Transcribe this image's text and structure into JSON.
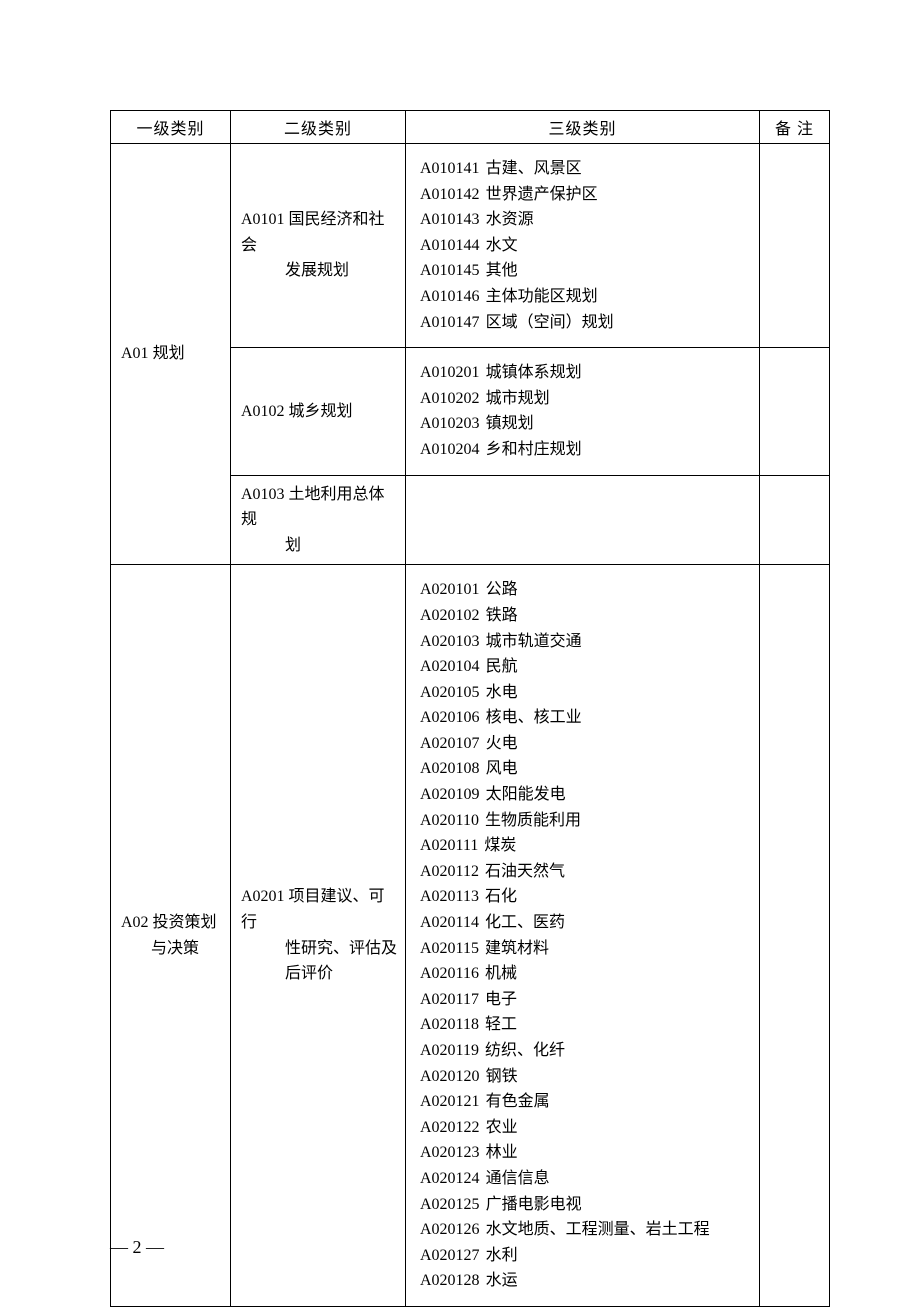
{
  "headers": {
    "c1": "一级类别",
    "c2": "二级类别",
    "c3": "三级类别",
    "c4": "备 注"
  },
  "lvl1": [
    {
      "code": "A01",
      "name": "规划"
    },
    {
      "code_line": "A02 投资策划",
      "line2": "与决策"
    }
  ],
  "lvl2": [
    {
      "line1": "A0101 国民经济和社会",
      "indent": "发展规划"
    },
    {
      "line1": "A0102 城乡规划"
    },
    {
      "line1": "A0103 土地利用总体规",
      "indent": "划"
    },
    {
      "line1": "A0201 项目建议、可行",
      "indent1": "性研究、评估及",
      "indent2": "后评价"
    }
  ],
  "lvl3_block_a0101": [
    {
      "code": "A010141",
      "name": "古建、风景区"
    },
    {
      "code": "A010142",
      "name": "世界遗产保护区"
    },
    {
      "code": "A010143",
      "name": "水资源"
    },
    {
      "code": "A010144",
      "name": "水文"
    },
    {
      "code": "A010145",
      "name": "其他"
    },
    {
      "code": "A010146",
      "name": "主体功能区规划"
    },
    {
      "code": "A010147",
      "name": "区域（空间）规划"
    }
  ],
  "lvl3_block_a0102": [
    {
      "code": "A010201",
      "name": "城镇体系规划"
    },
    {
      "code": "A010202",
      "name": "城市规划"
    },
    {
      "code": "A010203",
      "name": "镇规划"
    },
    {
      "code": "A010204",
      "name": "乡和村庄规划"
    }
  ],
  "lvl3_block_a0201": [
    {
      "code": "A020101",
      "name": "公路"
    },
    {
      "code": "A020102",
      "name": "铁路"
    },
    {
      "code": "A020103",
      "name": "城市轨道交通"
    },
    {
      "code": "A020104",
      "name": "民航"
    },
    {
      "code": "A020105",
      "name": "水电"
    },
    {
      "code": "A020106",
      "name": "核电、核工业"
    },
    {
      "code": "A020107",
      "name": "火电"
    },
    {
      "code": "A020108",
      "name": "风电"
    },
    {
      "code": "A020109",
      "name": "太阳能发电"
    },
    {
      "code": "A020110",
      "name": "生物质能利用"
    },
    {
      "code": "A020111",
      "name": "煤炭"
    },
    {
      "code": "A020112",
      "name": "石油天然气"
    },
    {
      "code": "A020113",
      "name": "石化"
    },
    {
      "code": "A020114",
      "name": "化工、医药"
    },
    {
      "code": "A020115",
      "name": "建筑材料"
    },
    {
      "code": "A020116",
      "name": "机械"
    },
    {
      "code": "A020117",
      "name": "电子"
    },
    {
      "code": "A020118",
      "name": "轻工"
    },
    {
      "code": "A020119",
      "name": "纺织、化纤"
    },
    {
      "code": "A020120",
      "name": "钢铁"
    },
    {
      "code": "A020121",
      "name": "有色金属"
    },
    {
      "code": "A020122",
      "name": "农业"
    },
    {
      "code": "A020123",
      "name": "林业"
    },
    {
      "code": "A020124",
      "name": "通信信息"
    },
    {
      "code": "A020125",
      "name": "广播电影电视"
    },
    {
      "code": "A020126",
      "name": "水文地质、工程测量、岩土工程"
    },
    {
      "code": "A020127",
      "name": "水利"
    },
    {
      "code": "A020128",
      "name": "水运"
    }
  ],
  "footer": "— 2 —"
}
